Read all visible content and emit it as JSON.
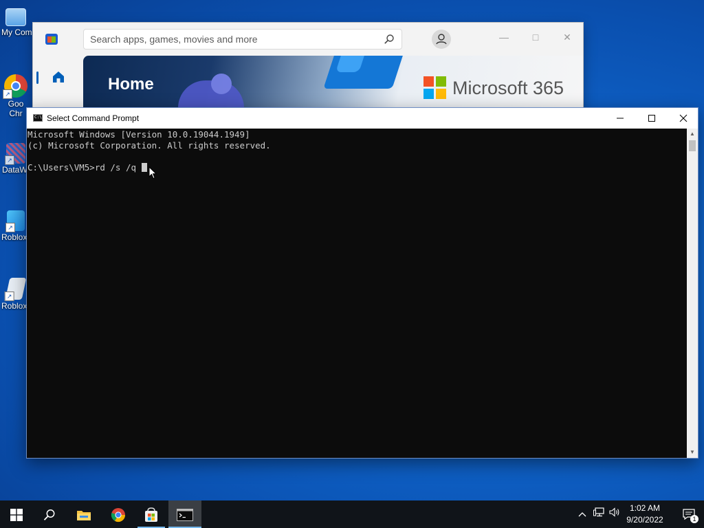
{
  "desktop": {
    "icons": [
      {
        "label": "My Com"
      },
      {
        "label": "Goo"
      },
      {
        "label": "Chr"
      },
      {
        "label": "DataW"
      },
      {
        "label": "Roblox"
      },
      {
        "label": "Roblox"
      }
    ]
  },
  "store": {
    "search_placeholder": "Search apps, games, movies and more",
    "hero_title": "Home",
    "brand_text": "Microsoft 365",
    "brand_colors": [
      "#f35325",
      "#81bc06",
      "#05a6f0",
      "#ffba08"
    ]
  },
  "cmd": {
    "title": "Select Command Prompt",
    "lines": [
      "Microsoft Windows [Version 10.0.19044.1949]",
      "(c) Microsoft Corporation. All rights reserved.",
      "",
      "C:\\Users\\VM5>rd /s /q "
    ],
    "icon_text": "C:\\"
  },
  "taskbar": {
    "time": "1:02 AM",
    "date": "9/20/2022",
    "notification_count": "1"
  },
  "colors": {
    "accent": "#005fb8",
    "desktop_blue": "#0f63c9",
    "console_bg": "#0c0c0c",
    "console_fg": "#cccccc"
  }
}
